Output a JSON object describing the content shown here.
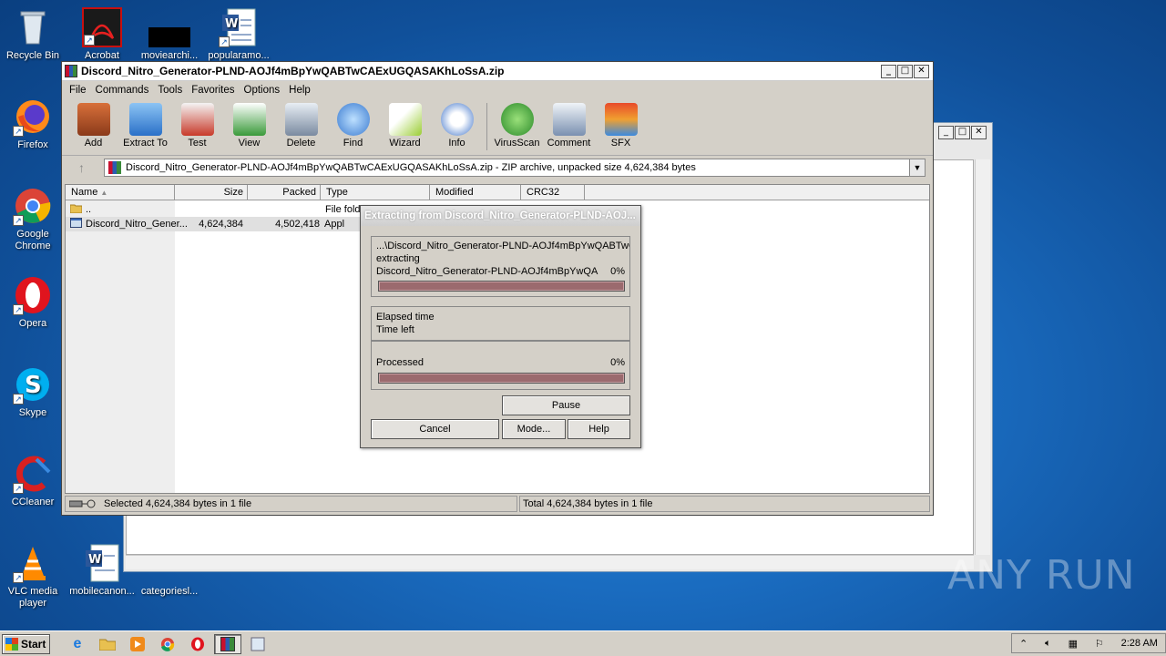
{
  "desktop": {
    "icons": [
      {
        "label": "Recycle Bin"
      },
      {
        "label": "Acrobat"
      },
      {
        "label": "moviearchi..."
      },
      {
        "label": "popularamo..."
      },
      {
        "label": "Firefox"
      },
      {
        "label": "Google Chrome"
      },
      {
        "label": "Opera"
      },
      {
        "label": "Skype"
      },
      {
        "label": "CCleaner"
      },
      {
        "label": "VLC media player"
      },
      {
        "label": "mobilecanon..."
      },
      {
        "label": "categoriesl..."
      }
    ]
  },
  "window": {
    "title": "Discord_Nitro_Generator-PLND-AOJf4mBpYwQABTwCAExUGQASAKhLoSsA.zip",
    "menu": [
      "File",
      "Commands",
      "Tools",
      "Favorites",
      "Options",
      "Help"
    ],
    "toolbar": [
      {
        "label": "Add",
        "icon": "add-icon",
        "color": "#b04a2a"
      },
      {
        "label": "Extract To",
        "icon": "extract-folder-icon",
        "color": "#3a86d8"
      },
      {
        "label": "Test",
        "icon": "test-clipboard-icon",
        "color": "#c83a2a"
      },
      {
        "label": "View",
        "icon": "view-book-icon",
        "color": "#3a9a3a"
      },
      {
        "label": "Delete",
        "icon": "trash-icon",
        "color": "#8a9ab0"
      },
      {
        "label": "Find",
        "icon": "magnifier-icon",
        "color": "#3a7ad0"
      },
      {
        "label": "Wizard",
        "icon": "wizard-wand-icon",
        "color": "#9acd32"
      },
      {
        "label": "Info",
        "icon": "info-icon",
        "color": "#3a70c8"
      },
      {
        "label": "VirusScan",
        "icon": "virus-scan-icon",
        "color": "#3aa03a"
      },
      {
        "label": "Comment",
        "icon": "comment-icon",
        "color": "#7a90b0"
      },
      {
        "label": "SFX",
        "icon": "sfx-box-icon",
        "color": "#d06a2a"
      }
    ],
    "address": "Discord_Nitro_Generator-PLND-AOJf4mBpYwQABTwCAExUGQASAKhLoSsA.zip - ZIP archive, unpacked size 4,624,384 bytes",
    "columns": [
      "Name",
      "Size",
      "Packed",
      "Type",
      "Modified",
      "CRC32"
    ],
    "rows": [
      {
        "name": "..",
        "size": "",
        "packed": "",
        "type": "File fold"
      },
      {
        "name": "Discord_Nitro_Gener...",
        "size": "4,624,384",
        "packed": "4,502,418",
        "type": "Appl"
      }
    ],
    "status_left": "Selected 4,624,384 bytes in 1 file",
    "status_right": "Total 4,624,384 bytes in 1 file"
  },
  "dialog": {
    "title": "Extracting from Discord_Nitro_Generator-PLND-AOJ...",
    "path_line": "...\\Discord_Nitro_Generator-PLND-AOJf4mBpYwQABTwC",
    "action": "extracting",
    "file_line": "Discord_Nitro_Generator-PLND-AOJf4mBpYwQA",
    "file_percent": "0%",
    "elapsed_label": "Elapsed time",
    "timeleft_label": "Time left",
    "processed_label": "Processed",
    "processed_percent": "0%",
    "buttons": {
      "pause": "Pause",
      "cancel": "Cancel",
      "mode": "Mode...",
      "help": "Help"
    }
  },
  "taskbar": {
    "start": "Start",
    "clock": "2:28 AM"
  },
  "watermark": "ANY RUN"
}
